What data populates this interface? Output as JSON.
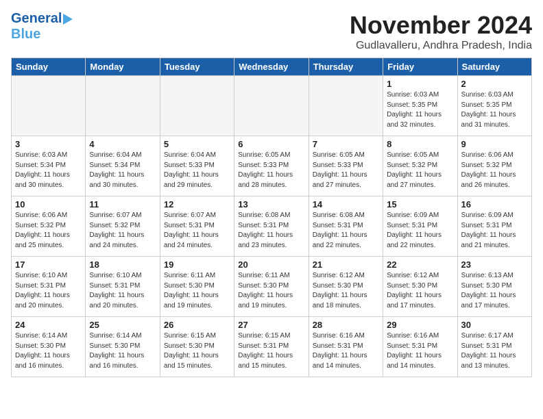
{
  "header": {
    "logo": {
      "line1": "General",
      "line2": "Blue"
    },
    "month": "November 2024",
    "location": "Gudlavalleru, Andhra Pradesh, India"
  },
  "weekdays": [
    "Sunday",
    "Monday",
    "Tuesday",
    "Wednesday",
    "Thursday",
    "Friday",
    "Saturday"
  ],
  "weeks": [
    [
      {
        "day": "",
        "empty": true
      },
      {
        "day": "",
        "empty": true
      },
      {
        "day": "",
        "empty": true
      },
      {
        "day": "",
        "empty": true
      },
      {
        "day": "",
        "empty": true
      },
      {
        "day": "1",
        "sunrise": "6:03 AM",
        "sunset": "5:35 PM",
        "daylight": "11 hours and 32 minutes."
      },
      {
        "day": "2",
        "sunrise": "6:03 AM",
        "sunset": "5:35 PM",
        "daylight": "11 hours and 31 minutes."
      }
    ],
    [
      {
        "day": "3",
        "sunrise": "6:03 AM",
        "sunset": "5:34 PM",
        "daylight": "11 hours and 30 minutes."
      },
      {
        "day": "4",
        "sunrise": "6:04 AM",
        "sunset": "5:34 PM",
        "daylight": "11 hours and 30 minutes."
      },
      {
        "day": "5",
        "sunrise": "6:04 AM",
        "sunset": "5:33 PM",
        "daylight": "11 hours and 29 minutes."
      },
      {
        "day": "6",
        "sunrise": "6:05 AM",
        "sunset": "5:33 PM",
        "daylight": "11 hours and 28 minutes."
      },
      {
        "day": "7",
        "sunrise": "6:05 AM",
        "sunset": "5:33 PM",
        "daylight": "11 hours and 27 minutes."
      },
      {
        "day": "8",
        "sunrise": "6:05 AM",
        "sunset": "5:32 PM",
        "daylight": "11 hours and 27 minutes."
      },
      {
        "day": "9",
        "sunrise": "6:06 AM",
        "sunset": "5:32 PM",
        "daylight": "11 hours and 26 minutes."
      }
    ],
    [
      {
        "day": "10",
        "sunrise": "6:06 AM",
        "sunset": "5:32 PM",
        "daylight": "11 hours and 25 minutes."
      },
      {
        "day": "11",
        "sunrise": "6:07 AM",
        "sunset": "5:32 PM",
        "daylight": "11 hours and 24 minutes."
      },
      {
        "day": "12",
        "sunrise": "6:07 AM",
        "sunset": "5:31 PM",
        "daylight": "11 hours and 24 minutes."
      },
      {
        "day": "13",
        "sunrise": "6:08 AM",
        "sunset": "5:31 PM",
        "daylight": "11 hours and 23 minutes."
      },
      {
        "day": "14",
        "sunrise": "6:08 AM",
        "sunset": "5:31 PM",
        "daylight": "11 hours and 22 minutes."
      },
      {
        "day": "15",
        "sunrise": "6:09 AM",
        "sunset": "5:31 PM",
        "daylight": "11 hours and 22 minutes."
      },
      {
        "day": "16",
        "sunrise": "6:09 AM",
        "sunset": "5:31 PM",
        "daylight": "11 hours and 21 minutes."
      }
    ],
    [
      {
        "day": "17",
        "sunrise": "6:10 AM",
        "sunset": "5:31 PM",
        "daylight": "11 hours and 20 minutes."
      },
      {
        "day": "18",
        "sunrise": "6:10 AM",
        "sunset": "5:31 PM",
        "daylight": "11 hours and 20 minutes."
      },
      {
        "day": "19",
        "sunrise": "6:11 AM",
        "sunset": "5:30 PM",
        "daylight": "11 hours and 19 minutes."
      },
      {
        "day": "20",
        "sunrise": "6:11 AM",
        "sunset": "5:30 PM",
        "daylight": "11 hours and 19 minutes."
      },
      {
        "day": "21",
        "sunrise": "6:12 AM",
        "sunset": "5:30 PM",
        "daylight": "11 hours and 18 minutes."
      },
      {
        "day": "22",
        "sunrise": "6:12 AM",
        "sunset": "5:30 PM",
        "daylight": "11 hours and 17 minutes."
      },
      {
        "day": "23",
        "sunrise": "6:13 AM",
        "sunset": "5:30 PM",
        "daylight": "11 hours and 17 minutes."
      }
    ],
    [
      {
        "day": "24",
        "sunrise": "6:14 AM",
        "sunset": "5:30 PM",
        "daylight": "11 hours and 16 minutes."
      },
      {
        "day": "25",
        "sunrise": "6:14 AM",
        "sunset": "5:30 PM",
        "daylight": "11 hours and 16 minutes."
      },
      {
        "day": "26",
        "sunrise": "6:15 AM",
        "sunset": "5:30 PM",
        "daylight": "11 hours and 15 minutes."
      },
      {
        "day": "27",
        "sunrise": "6:15 AM",
        "sunset": "5:31 PM",
        "daylight": "11 hours and 15 minutes."
      },
      {
        "day": "28",
        "sunrise": "6:16 AM",
        "sunset": "5:31 PM",
        "daylight": "11 hours and 14 minutes."
      },
      {
        "day": "29",
        "sunrise": "6:16 AM",
        "sunset": "5:31 PM",
        "daylight": "11 hours and 14 minutes."
      },
      {
        "day": "30",
        "sunrise": "6:17 AM",
        "sunset": "5:31 PM",
        "daylight": "11 hours and 13 minutes."
      }
    ]
  ]
}
